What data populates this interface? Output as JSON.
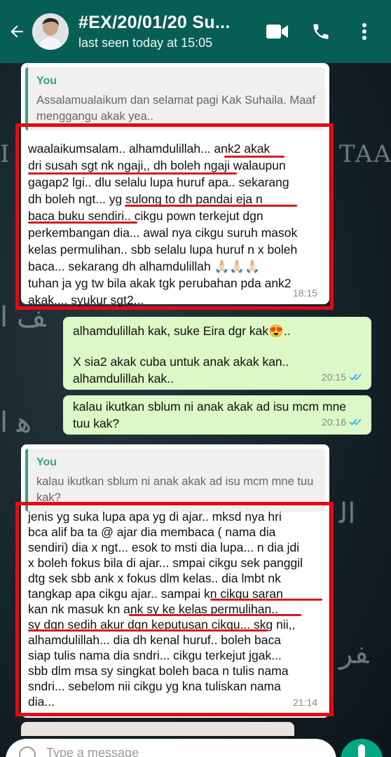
{
  "header": {
    "title": "#EX/20/01/20 Su...",
    "status": "last seen today at 15:05",
    "icons": [
      "back-arrow-icon",
      "video-call-icon",
      "voice-call-icon",
      "more-options-icon"
    ]
  },
  "messages": [
    {
      "quote_name": "You",
      "quote_text": "Assalamualaikum dan selamat pagi Kak Suhaila. Maaf menggangu akak yea..",
      "lines": [
        "waalaikumsalam.. alhamdulillah... ank2 akak",
        "dri susah sgt nk ngaji,, dh boleh ngaji walaupun",
        "gagap2 lgi.. dlu selalu lupa huruf apa.. sekarang",
        "dh boleh ngt... yg sulong to dh pandai eja n",
        "baca buku sendiri.. cikgu pown terkejut dgn",
        "perkembangan dia... awal nya cikgu suruh masok",
        "kelas permulihan.. sbb selalu lupa huruf n x boleh",
        "baca... sekarang dh alhamdulillah 🙏🏻🙏🏻🙏🏻",
        "tuhan ja yg tw bila akak tgk perubahan pda ank2",
        "akak.... syukur sgt2..."
      ],
      "time": "18:15"
    },
    {
      "lines": [
        "alhamdulillah kak, suke Eira dgr kak😍..",
        "",
        "X sia2 akak cuba untuk anak akak kan..",
        "alhamdulillah kak.."
      ],
      "time": "20:15"
    },
    {
      "lines": [
        "kalau ikutkan sblum ni anak akak ad isu mcm mne",
        "tuu kak?"
      ],
      "time": "20:16"
    },
    {
      "quote_name": "You",
      "quote_text": "kalau ikutkan sblum ni anak akak ad isu mcm mne tuu kak?",
      "lines": [
        "jenis yg suka lupa apa yg di ajar.. mksd nya hri",
        "bca alif ba ta @ ajar dia membaca ( nama dia",
        "sendiri) dia x ngt... esok to msti dia lupa... n dia jdi",
        "x boleh fokus bila di ajar... smpai cikgu sek panggil",
        "dtg sek sbb ank x fokus dlm kelas.. dia lmbt nk",
        "tangkap apa cikgu ajar.. sampai kn cikgu saran",
        "kan nk masuk kn ank sy ke kelas permulihan..",
        "sy dgn sedih akur dgn keputusan cikgu... skg nii,,",
        "alhamdulillah... dia dh kenal huruf.. boleh baca",
        "siap tulis nama dia sndri... cikgu terkejut jgak...",
        "sbb dlm msa sy singkat boleh baca n tulis nama",
        "sndri... sebelom nii cikgu yg kna tuliskan nama",
        "dia..."
      ],
      "time": "21:14"
    }
  ],
  "input": {
    "placeholder": "Type a message"
  },
  "colors": {
    "header": "#075e54",
    "outgoing": "#dcf8c6",
    "incoming": "#ffffff",
    "highlight": "#e50914",
    "quote_accent": "#35a37a",
    "read_ticks": "#34b7f1"
  }
}
